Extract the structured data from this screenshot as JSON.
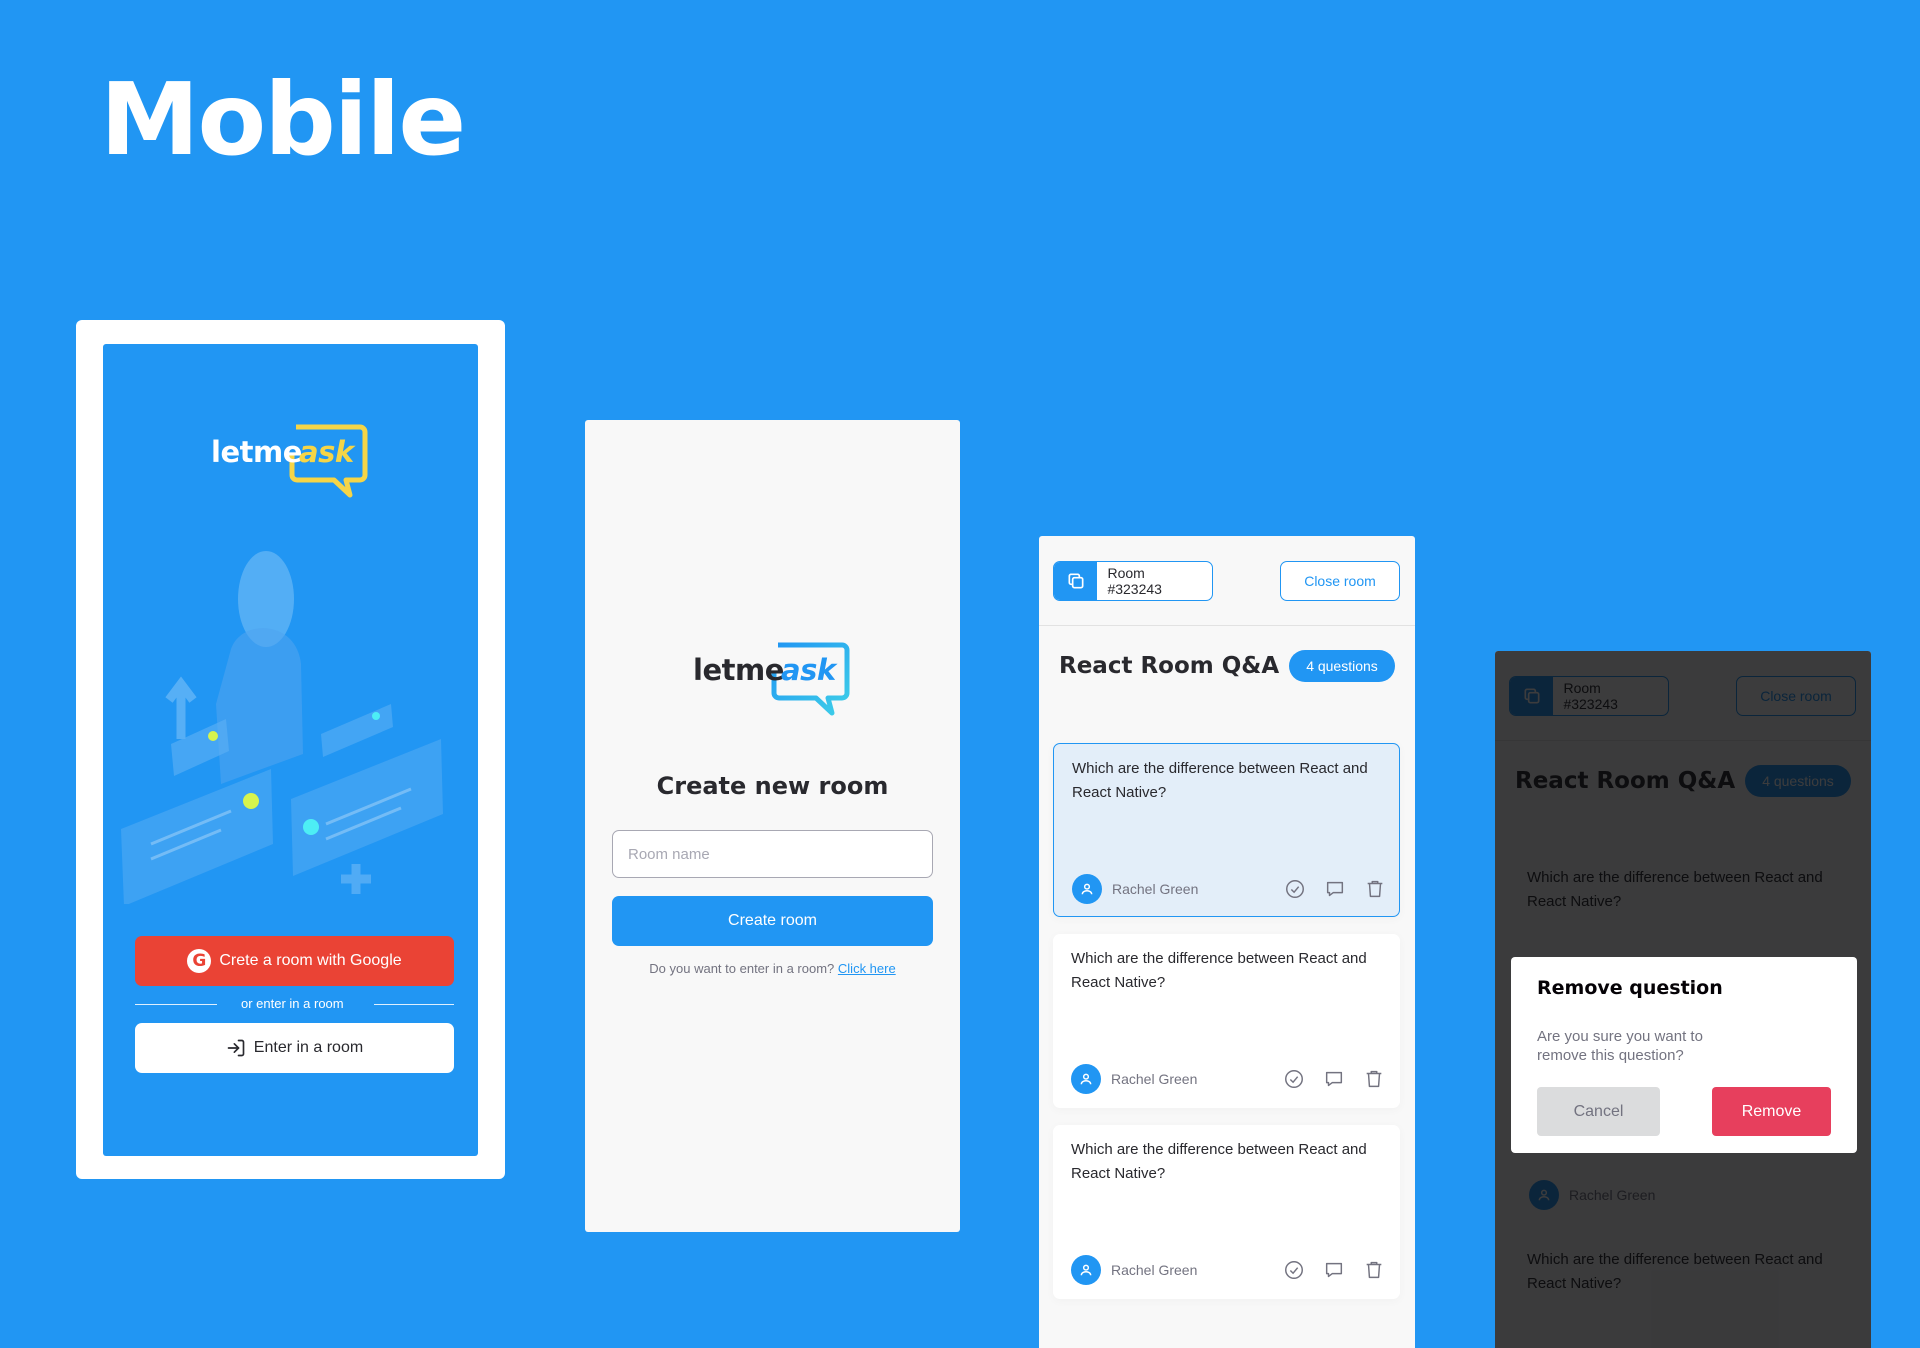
{
  "page": {
    "title": "Mobile"
  },
  "brand": {
    "logo_part1": "letme",
    "logo_part2": "ask"
  },
  "login": {
    "google_button": "Crete a room with Google",
    "separator": "or enter in a room",
    "enter_button": "Enter in a room"
  },
  "create_room": {
    "title": "Create new room",
    "input_placeholder": "Room name",
    "input_value": "",
    "submit_button": "Create room",
    "hint_text": "Do you want to enter in a room?",
    "hint_link": "Click here"
  },
  "room": {
    "room_code": "Room #323243",
    "close_button": "Close room",
    "title": "React Room Q&A",
    "badge": "4 questions",
    "questions": [
      {
        "text": "Which are the difference between React and React Native?",
        "author": "Rachel Green",
        "highlighted": true
      },
      {
        "text": "Which are the difference between React and React Native?",
        "author": "Rachel Green",
        "highlighted": false
      },
      {
        "text": "Which are the difference between React and React Native?",
        "author": "Rachel Green",
        "highlighted": false
      }
    ]
  },
  "modal": {
    "title": "Remove question",
    "message": "Are you sure you want to remove this question?",
    "cancel_button": "Cancel",
    "confirm_button": "Remove"
  },
  "colors": {
    "background": "#2196F3",
    "primary": "#2196F3",
    "google_red": "#EA4335",
    "danger": "#E73F5D",
    "logo_yellow": "#F5D547",
    "logo_cyan": "#3ECFE8",
    "text_dark": "#29292E",
    "text_muted": "#737380"
  },
  "icons": {
    "copy": "copy-icon",
    "check": "check-circle-icon",
    "comment": "message-icon",
    "delete": "trash-icon",
    "login": "log-in-icon",
    "user": "user-icon",
    "google": "google-icon"
  }
}
